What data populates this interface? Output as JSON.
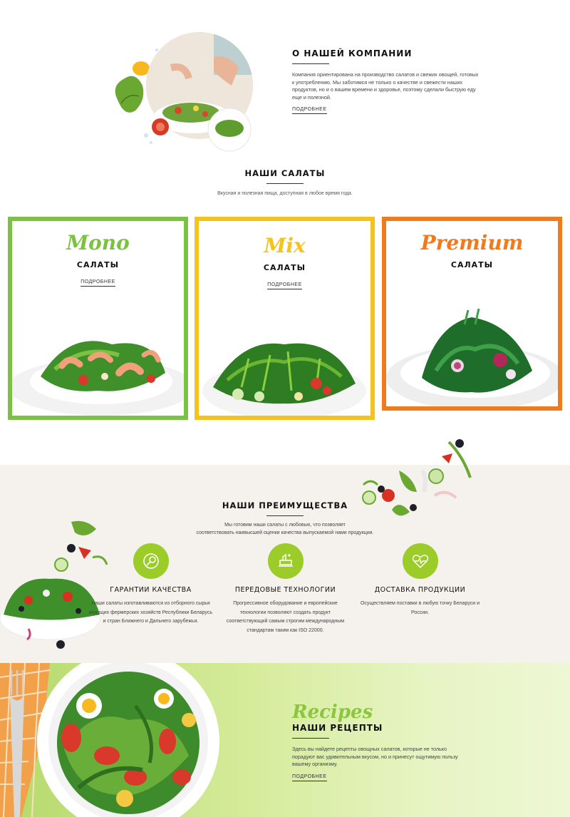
{
  "about": {
    "title": "О НАШЕЙ КОМПАНИИ",
    "text": "Компания ориентирована на производство салатов и свежих овощей, готовых к употреблению. Мы заботимся не только о качестве и свежести наших продуктов, но и о вашем времени и здоровье, поэтому сделали быструю еду еще и полезной.",
    "more": "ПОДРОБНЕЕ"
  },
  "salads": {
    "title": "НАШИ САЛАТЫ",
    "subtitle": "Вкусная и полезная пища, доступная в любое время года.",
    "cards": [
      {
        "script": "Mono",
        "title": "САЛАТЫ",
        "more": "ПОДРОБНЕЕ",
        "color": "#7cc242"
      },
      {
        "script": "Mix",
        "title": "САЛАТЫ",
        "more": "ПОДРОБНЕЕ",
        "color": "#f6c21c"
      },
      {
        "script": "Premium",
        "title": "САЛАТЫ",
        "color": "#f07a1c"
      }
    ]
  },
  "advantages": {
    "title": "НАШИ ПРЕИМУЩЕСТВА",
    "subtitle_line1": "Мы готовим наши салаты с любовью, что позволяет",
    "subtitle_line2": "соответствовать наивысшей оценки качества выпускаемой нами продукции.",
    "items": [
      {
        "icon": "quality-icon",
        "title": "ГАРАНТИИ КАЧЕСТВА",
        "text": "Наши салаты изготавливаются из отборного сырья ведущих фермерских хозяйств Республики Беларусь и стран Ближнего и Дальнего зарубежья."
      },
      {
        "icon": "technology-icon",
        "title": "ПЕРЕДОВЫЕ ТЕХНОЛОГИИ",
        "text": "Прогрессивное оборудование и европейские технологии позволяют создать продукт соответствующий самым строгим международным стандартам таким как ISO 22000."
      },
      {
        "icon": "heart-pulse-icon",
        "title": "ДОСТАВКА ПРОДУКЦИИ",
        "text": "Осуществляем поставки в любую точку Беларуси и России."
      }
    ],
    "accent": "#9ccc2a"
  },
  "recipes": {
    "script": "Recipes",
    "title": "НАШИ РЕЦЕПТЫ",
    "text": "Здесь вы найдете рецепты овощных салатов, которые не только порадуют вас удивительным вкусом, но и принесут ощутимую пользу вашему организму.",
    "more": "ПОДРОБНЕЕ",
    "script_color": "#8cc63f"
  }
}
